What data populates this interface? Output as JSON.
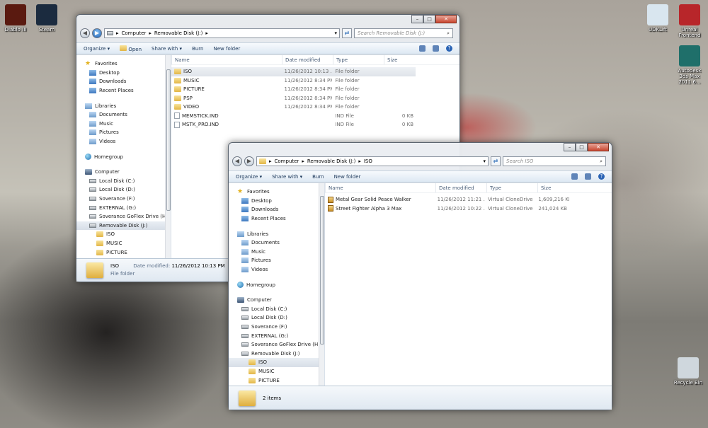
{
  "desktop": {
    "icons_left": [
      {
        "label": "Diablo III",
        "name": "diablo-iii-icon",
        "color": "#5a1a10"
      },
      {
        "label": "Steam",
        "name": "steam-icon",
        "color": "#1b2b3f"
      }
    ],
    "icons_right": [
      {
        "label": "UDKLift",
        "name": "udklift-icon",
        "color": "#d9e6ef"
      },
      {
        "label": "Unreal Frontend",
        "name": "unreal-frontend-icon",
        "color": "#b8262a"
      },
      {
        "label": "Autodesk 3ds Max 2011 6...",
        "name": "3ds-max-icon",
        "color": "#1f6f6a"
      },
      {
        "label": "Recycle Bin",
        "name": "recycle-bin-icon",
        "color": "#cfd7dd"
      }
    ]
  },
  "window1": {
    "caption": {
      "minimize": "–",
      "maximize": "□",
      "close": "✕"
    },
    "breadcrumb": [
      "Computer",
      "Removable Disk (J:)"
    ],
    "search_placeholder": "Search Removable Disk (J:)",
    "toolbar": {
      "organize": "Organize ▾",
      "open": "Open",
      "share": "Share with ▾",
      "burn": "Burn",
      "new_folder": "New folder"
    },
    "columns": {
      "name": "Name",
      "date": "Date modified",
      "type": "Type",
      "size": "Size"
    },
    "files": [
      {
        "name": "ISO",
        "date": "11/26/2012 10:13 ...",
        "type": "File folder",
        "size": "",
        "kind": "folder"
      },
      {
        "name": "MUSIC",
        "date": "11/26/2012 8:34 PM",
        "type": "File folder",
        "size": "",
        "kind": "folder"
      },
      {
        "name": "PICTURE",
        "date": "11/26/2012 8:34 PM",
        "type": "File folder",
        "size": "",
        "kind": "folder"
      },
      {
        "name": "PSP",
        "date": "11/26/2012 8:34 PM",
        "type": "File folder",
        "size": "",
        "kind": "folder"
      },
      {
        "name": "VIDEO",
        "date": "11/26/2012 8:34 PM",
        "type": "File folder",
        "size": "",
        "kind": "folder"
      },
      {
        "name": "MEMSTICK.IND",
        "date": "",
        "type": "IND File",
        "size": "0 KB",
        "kind": "file"
      },
      {
        "name": "MSTK_PRO.IND",
        "date": "",
        "type": "IND File",
        "size": "0 KB",
        "kind": "file"
      }
    ],
    "details": {
      "name": "ISO",
      "date_label": "Date modified:",
      "date_value": "11/26/2012 10:13 PM",
      "type": "File folder"
    }
  },
  "window2": {
    "caption": {
      "minimize": "–",
      "maximize": "□",
      "close": "✕"
    },
    "breadcrumb": [
      "Computer",
      "Removable Disk (J:)",
      "ISO"
    ],
    "search_placeholder": "Search ISO",
    "toolbar": {
      "organize": "Organize ▾",
      "share": "Share with ▾",
      "burn": "Burn",
      "new_folder": "New folder"
    },
    "columns": {
      "name": "Name",
      "date": "Date modified",
      "type": "Type",
      "size": "Size"
    },
    "files": [
      {
        "name": "Metal Gear Solid Peace Walker",
        "date": "11/26/2012 11:21 ...",
        "type": "Virtual CloneDrive",
        "size": "1,609,216 KB"
      },
      {
        "name": "Street Fighter Alpha 3 Max",
        "date": "11/26/2012 10:22 ...",
        "type": "Virtual CloneDrive",
        "size": "241,024 KB"
      }
    ],
    "status": "2 items"
  },
  "nav_tree": [
    {
      "label": "Favorites",
      "icon": "star",
      "level": 0
    },
    {
      "label": "Desktop",
      "icon": "blue",
      "level": 1
    },
    {
      "label": "Downloads",
      "icon": "blue",
      "level": 1
    },
    {
      "label": "Recent Places",
      "icon": "blue",
      "level": 1
    },
    {
      "label": "",
      "icon": "",
      "level": -1
    },
    {
      "label": "Libraries",
      "icon": "lib",
      "level": 0
    },
    {
      "label": "Documents",
      "icon": "lib",
      "level": 1
    },
    {
      "label": "Music",
      "icon": "lib",
      "level": 1
    },
    {
      "label": "Pictures",
      "icon": "lib",
      "level": 1
    },
    {
      "label": "Videos",
      "icon": "lib",
      "level": 1
    },
    {
      "label": "",
      "icon": "",
      "level": -1
    },
    {
      "label": "Homegroup",
      "icon": "net",
      "level": 0
    },
    {
      "label": "",
      "icon": "",
      "level": -1
    },
    {
      "label": "Computer",
      "icon": "comp",
      "level": 0
    },
    {
      "label": "Local Disk (C:)",
      "icon": "drive",
      "level": 1
    },
    {
      "label": "Local Disk (D:)",
      "icon": "drive",
      "level": 1
    },
    {
      "label": "Soverance (F:)",
      "icon": "drive",
      "level": 1
    },
    {
      "label": "EXTERNAL (G:)",
      "icon": "drive",
      "level": 1
    },
    {
      "label": "Soverance GoFlex Drive (H:)",
      "icon": "drive",
      "level": 1
    },
    {
      "label": "Removable Disk (J:)",
      "icon": "drive",
      "level": 1
    },
    {
      "label": "ISO",
      "icon": "folder",
      "level": 2
    },
    {
      "label": "MUSIC",
      "icon": "folder",
      "level": 2
    },
    {
      "label": "PICTURE",
      "icon": "folder",
      "level": 2
    }
  ]
}
